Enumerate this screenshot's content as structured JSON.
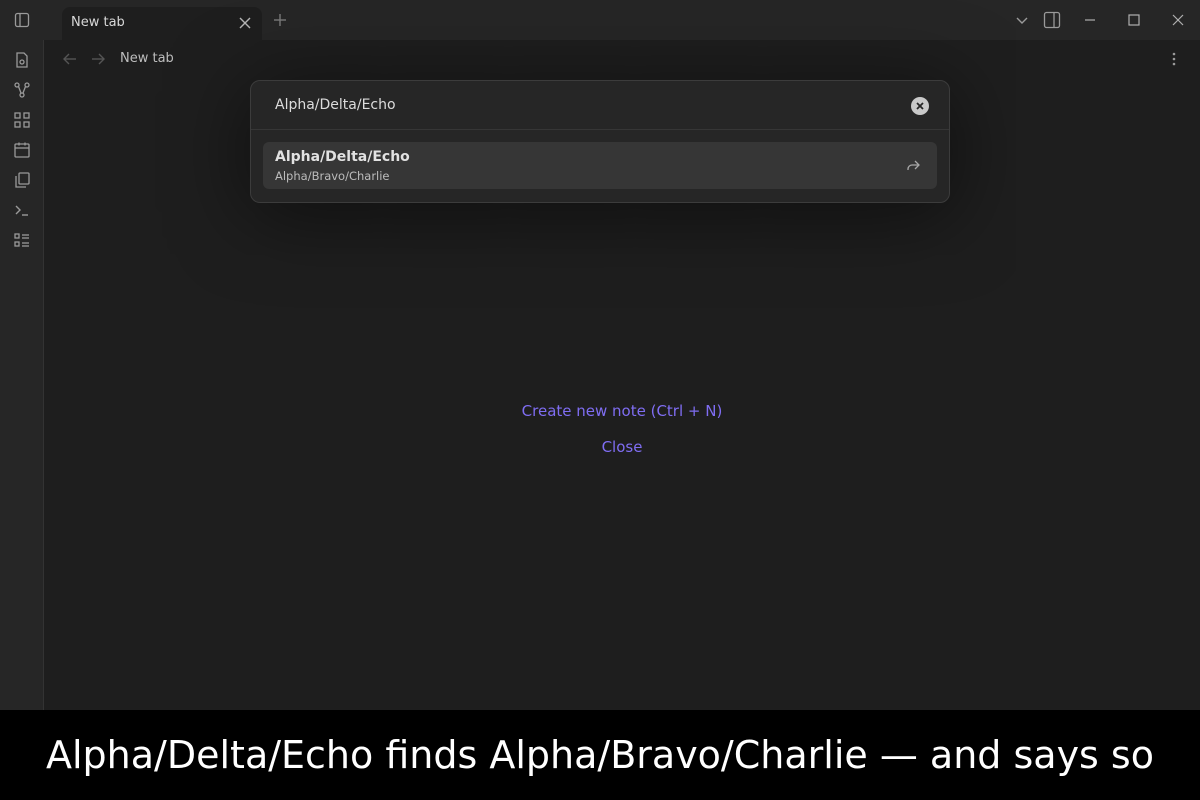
{
  "titlebar": {
    "tab_label": "New tab",
    "icons": [
      "sidebar-toggle-icon",
      "close-icon",
      "plus-icon",
      "chevron-down-icon",
      "right-sidebar-icon",
      "minimize-icon",
      "maximize-icon",
      "window-close-icon"
    ]
  },
  "ribbon": {
    "icons": [
      "file-icon",
      "graph-icon",
      "grid-icon",
      "calendar-icon",
      "copy-icon",
      "terminal-icon",
      "list-icon"
    ]
  },
  "navbar": {
    "title": "New tab",
    "icons": [
      "arrow-left-icon",
      "arrow-right-icon",
      "more-vertical-icon"
    ]
  },
  "empty_state": {
    "create_label": "Create new note (Ctrl + N)",
    "close_label": "Close"
  },
  "switcher": {
    "query": "Alpha/Delta/Echo",
    "suggestions": [
      {
        "title": "Alpha/Delta/Echo",
        "path": "Alpha/Bravo/Charlie"
      }
    ]
  },
  "caption": "Alpha/Delta/Echo finds Alpha/Bravo/Charlie — and says so",
  "colors": {
    "accent": "#7f6df2",
    "background": "#1e1e1e",
    "panel": "#262626"
  }
}
